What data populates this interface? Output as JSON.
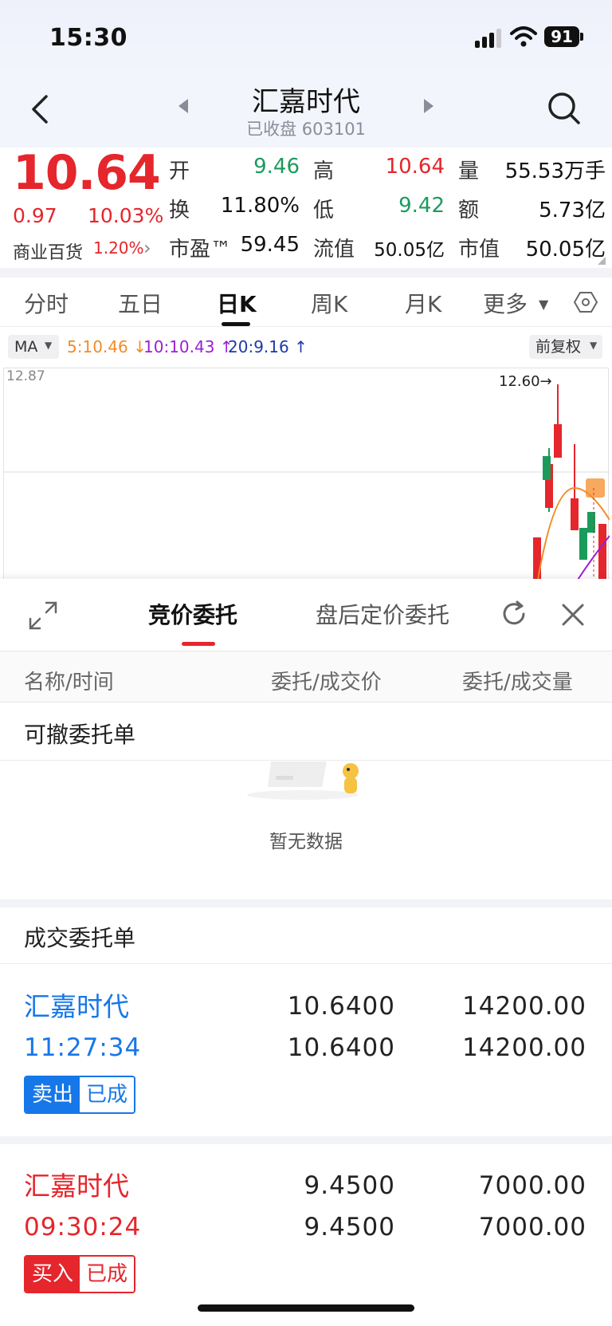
{
  "status_bar": {
    "time": "15:30",
    "battery": "91"
  },
  "header": {
    "stock_name": "汇嘉时代",
    "stock_sub": "已收盘 603101"
  },
  "quote": {
    "price": "10.64",
    "change": "0.97",
    "change_pct": "10.03%",
    "sector_name": "商业百货",
    "sector_pct": "1.20%",
    "rows": [
      [
        {
          "label": "开",
          "value": "9.46"
        },
        {
          "label": "高",
          "value": "10.64"
        },
        {
          "label": "量",
          "value": "55.53万手"
        }
      ],
      [
        {
          "label": "换",
          "value": "11.80%"
        },
        {
          "label": "低",
          "value": "9.42"
        },
        {
          "label": "额",
          "value": "5.73亿"
        }
      ],
      [
        {
          "label": "市盈™",
          "value": "59.45"
        },
        {
          "label": "流值",
          "value": "50.05亿"
        },
        {
          "label": "市值",
          "value": "50.05亿"
        }
      ]
    ]
  },
  "chart_tabs": [
    "分时",
    "五日",
    "日K",
    "周K",
    "月K",
    "更多"
  ],
  "ma": {
    "label": "MA",
    "ma5": "5:10.46 ↓",
    "ma10": "10:10.43 ↑",
    "ma20": "20:9.16 ↑",
    "adjust": "前复权"
  },
  "chart": {
    "max_label": "12.87",
    "high_marker": "12.60→"
  },
  "colors": {
    "up": "#e5262c",
    "down": "#1a9b5c",
    "accent_blue": "#1677e8"
  },
  "sheet": {
    "tabs": [
      "竞价委托",
      "盘后定价委托"
    ],
    "columns": [
      "名称/时间",
      "委托/成交价",
      "委托/成交量"
    ],
    "cancelable_title": "可撤委托单",
    "empty_text": "暂无数据",
    "filled_title": "成交委托单",
    "orders": [
      {
        "name": "汇嘉时代",
        "time": "11:27:34",
        "price1": "10.6400",
        "price2": "10.6400",
        "qty1": "14200.00",
        "qty2": "14200.00",
        "side": "卖出",
        "status": "已成"
      },
      {
        "name": "汇嘉时代",
        "time": "09:30:24",
        "price1": "9.4500",
        "price2": "9.4500",
        "qty1": "7000.00",
        "qty2": "7000.00",
        "side": "买入",
        "status": "已成"
      }
    ]
  }
}
